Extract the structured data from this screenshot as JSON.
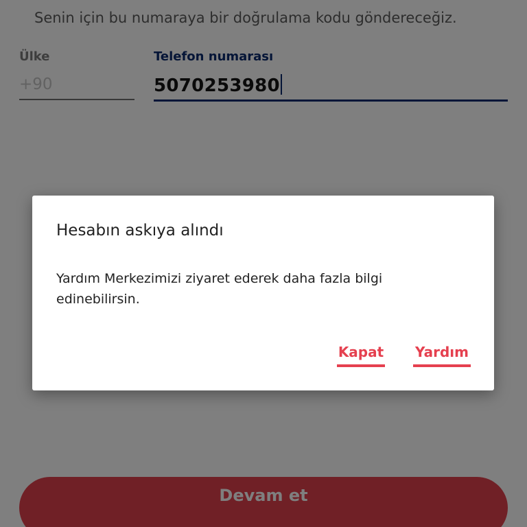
{
  "form": {
    "subtitle": "Senin için bu numaraya bir doğrulama kodu göndereceğiz.",
    "country_label": "Ülke",
    "country_code": "+90",
    "phone_label": "Telefon numarası",
    "phone_value": "5070253980",
    "continue_label": "Devam et"
  },
  "dialog": {
    "title": "Hesabın askıya alındı",
    "message": "Yardım Merkezimizi ziyaret ederek daha fazla bilgi edinebilirsin.",
    "close_label": "Kapat",
    "help_label": "Yardım"
  },
  "colors": {
    "accent": "#e5404f",
    "field_focus": "#0a2a6e"
  }
}
